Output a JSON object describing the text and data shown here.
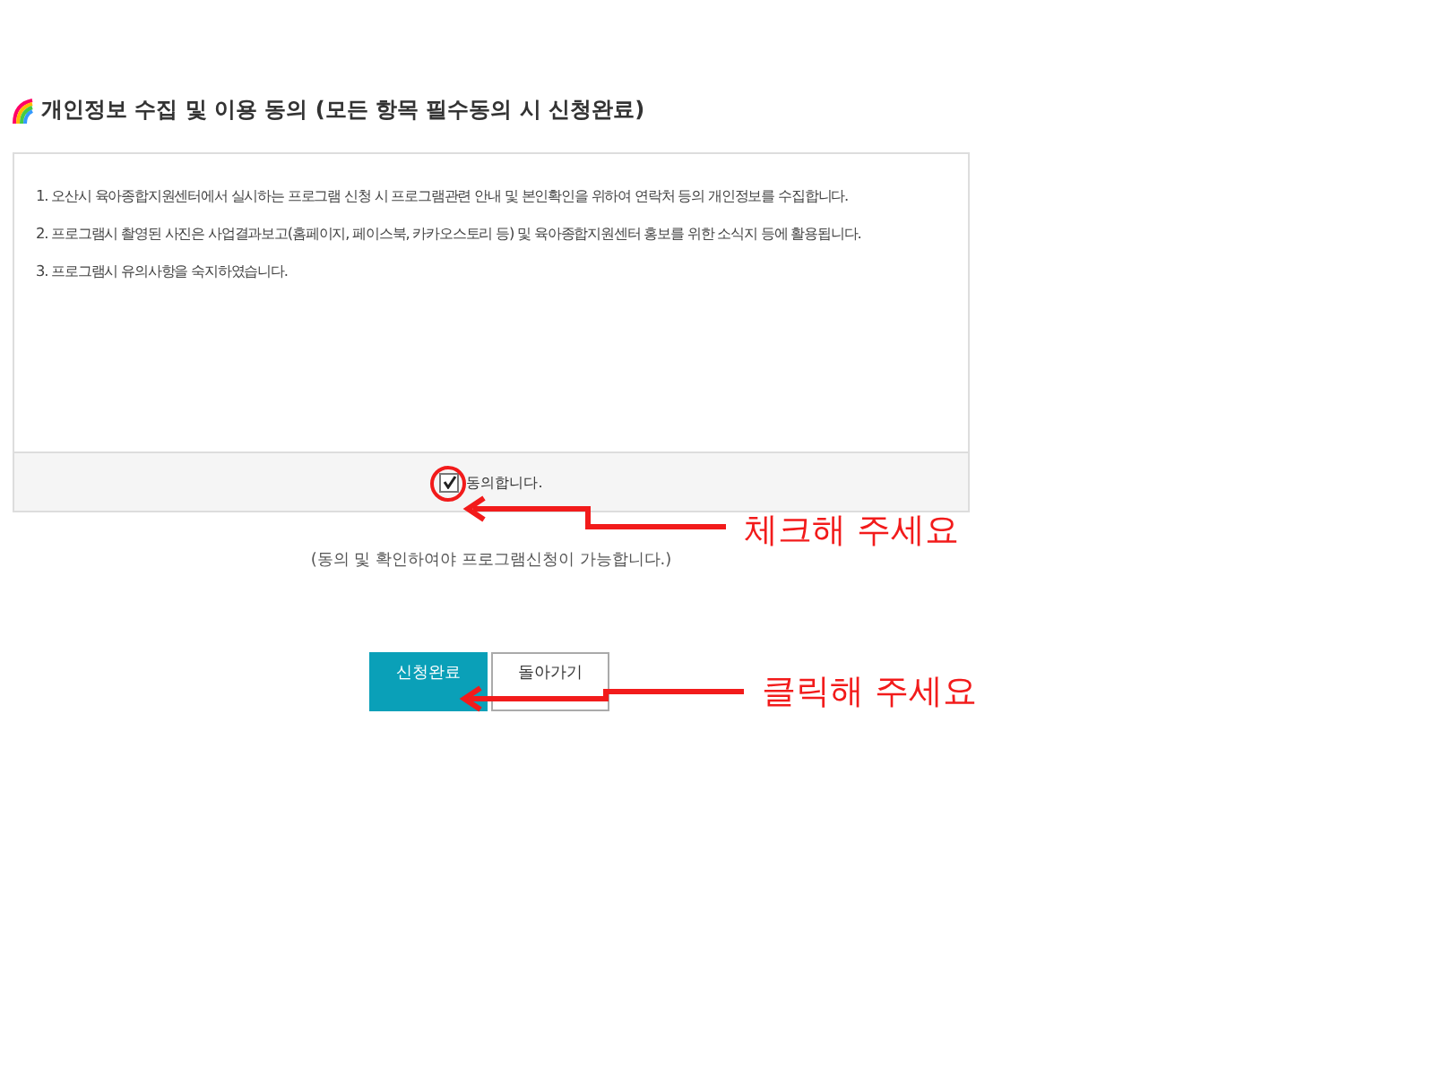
{
  "heading": "개인정보 수집 및 이용 동의 (모든 항목 필수동의 시 신청완료)",
  "terms": [
    "1. 오산시 육아종합지원센터에서 실시하는 프로그램 신청 시 프로그램관련 안내 및 본인확인을 위하여 연락처 등의 개인정보를 수집합니다.",
    "2. 프로그램시 촬영된 사진은 사업결과보고(홈페이지, 페이스북, 카카오스토리 등) 및 육아종합지원센터 홍보를 위한 소식지 등에 활용됩니다.",
    "3. 프로그램시 유의사항을 숙지하였습니다."
  ],
  "agree": {
    "label": "동의합니다.",
    "checked": true
  },
  "note": "(동의 및 확인하여야 프로그램신청이 가능합니다.)",
  "buttons": [
    {
      "label": "신청완료",
      "kind": "primary"
    },
    {
      "label": "돌아가기",
      "kind": "secondary"
    }
  ],
  "annotations": [
    {
      "text": "체크해 주세요"
    },
    {
      "text": "클릭해 주세요"
    }
  ]
}
